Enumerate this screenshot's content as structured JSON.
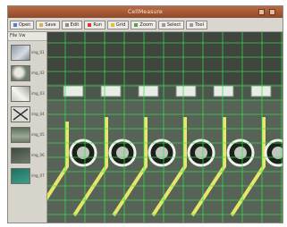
{
  "window": {
    "title": "CellMeasure"
  },
  "toolbar": {
    "buttons": [
      {
        "label": "Open",
        "icon": "open-icon",
        "color": "#5b7bd6"
      },
      {
        "label": "Save",
        "icon": "save-icon",
        "color": "#d6b35b"
      },
      {
        "label": "Edit",
        "icon": "edit-icon",
        "color": "#8a8a8a"
      },
      {
        "label": "Run",
        "icon": "run-icon",
        "color": "#d33a2c"
      },
      {
        "label": "Grid",
        "icon": "grid-icon",
        "color": "#e0c23a"
      },
      {
        "label": "Zoom",
        "icon": "zoom-icon",
        "color": "#5aa15a"
      },
      {
        "label": "Select",
        "icon": "select-icon",
        "color": "#9a9a9a"
      },
      {
        "label": "Tool",
        "icon": "tool-icon",
        "color": "#9a9a9a"
      }
    ]
  },
  "sidebar": {
    "header": "File  Vw",
    "thumbnails": [
      {
        "label": "img_01"
      },
      {
        "label": "img_02"
      },
      {
        "label": "img_03"
      },
      {
        "label": "img_04"
      },
      {
        "label": "img_05"
      },
      {
        "label": "img_06"
      },
      {
        "label": "img_07"
      }
    ]
  },
  "viewer": {
    "grid_color": "#3be04a",
    "trace_color": "#e7e66b",
    "pad_count": 6
  }
}
